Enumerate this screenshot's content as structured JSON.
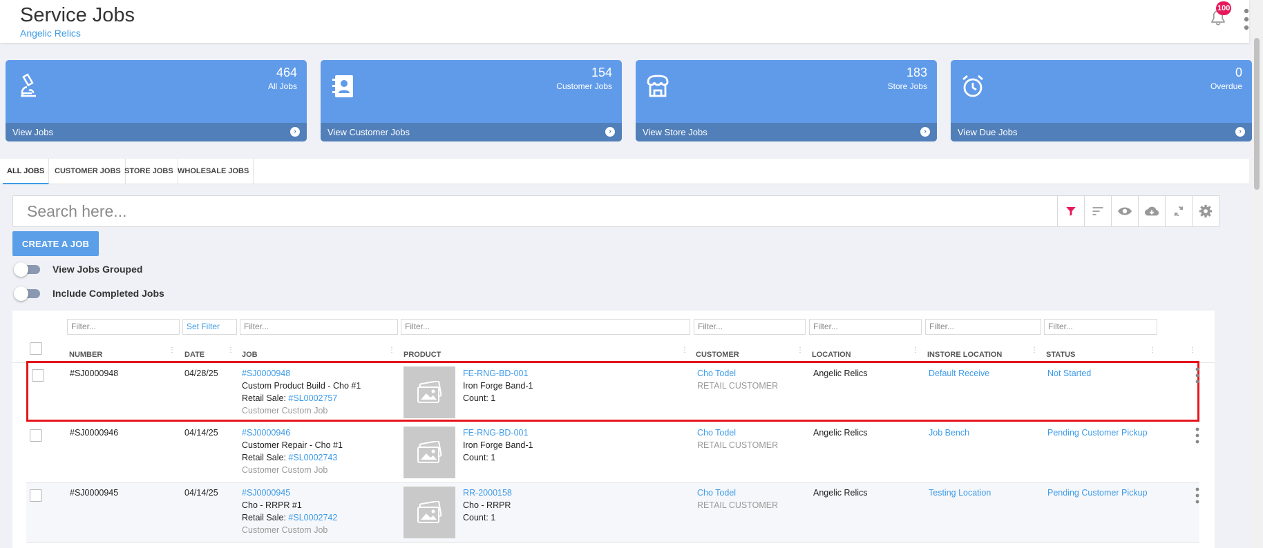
{
  "header": {
    "title": "Service Jobs",
    "subtitle": "Angelic Relics",
    "notification_count": "100"
  },
  "cards": [
    {
      "count": "464",
      "label": "All Jobs",
      "link": "View Jobs",
      "icon": "microscope-icon"
    },
    {
      "count": "154",
      "label": "Customer Jobs",
      "link": "View Customer Jobs",
      "icon": "contact-book-icon"
    },
    {
      "count": "183",
      "label": "Store Jobs",
      "link": "View Store Jobs",
      "icon": "store-icon"
    },
    {
      "count": "0",
      "label": "Overdue",
      "link": "View Due Jobs",
      "icon": "alarm-clock-icon"
    }
  ],
  "tabs": [
    "ALL JOBS",
    "CUSTOMER JOBS",
    "STORE JOBS",
    "WHOLESALE JOBS"
  ],
  "search": {
    "placeholder": "Search here..."
  },
  "toolbar_icons": [
    "filter-icon",
    "sort-icon",
    "eye-icon",
    "cloud-download-icon",
    "refresh-icon",
    "settings-icon"
  ],
  "create_button": "CREATE A JOB",
  "toggles": [
    {
      "label": "View Jobs Grouped",
      "on": false
    },
    {
      "label": "Include Completed Jobs",
      "on": false
    }
  ],
  "filters": {
    "placeholder": "Filter...",
    "set_filter": "Set Filter"
  },
  "columns": [
    "NUMBER",
    "DATE",
    "JOB",
    "PRODUCT",
    "CUSTOMER",
    "LOCATION",
    "INSTORE LOCATION",
    "STATUS"
  ],
  "rows": [
    {
      "number": "#SJ0000948",
      "date": "04/28/25",
      "job_id": "#SJ0000948",
      "job_title": "Custom Product Build - Cho #1",
      "retail_label": "Retail Sale:",
      "retail_sale": "#SL0002757",
      "job_type": "Customer Custom Job",
      "sku": "FE-RNG-BD-001",
      "product": "Iron Forge Band-1",
      "count": "Count: 1",
      "customer": "Cho Todel",
      "customer_type": "RETAIL CUSTOMER",
      "location": "Angelic Relics",
      "instore": "Default Receive",
      "status": "Not Started"
    },
    {
      "number": "#SJ0000946",
      "date": "04/14/25",
      "job_id": "#SJ0000946",
      "job_title": "Customer Repair - Cho #1",
      "retail_label": "Retail Sale:",
      "retail_sale": "#SL0002743",
      "job_type": "Customer Custom Job",
      "sku": "FE-RNG-BD-001",
      "product": "Iron Forge Band-1",
      "count": "Count: 1",
      "customer": "Cho Todel",
      "customer_type": "RETAIL CUSTOMER",
      "location": "Angelic Relics",
      "instore": "Job Bench",
      "status": "Pending Customer Pickup"
    },
    {
      "number": "#SJ0000945",
      "date": "04/14/25",
      "job_id": "#SJ0000945",
      "job_title": "Cho - RRPR #1",
      "retail_label": "Retail Sale:",
      "retail_sale": "#SL0002742",
      "job_type": "Customer Custom Job",
      "sku": "RR-2000158",
      "product": "Cho - RRPR",
      "count": "Count: 1",
      "customer": "Cho Todel",
      "customer_type": "RETAIL CUSTOMER",
      "location": "Angelic Relics",
      "instore": "Testing Location",
      "status": "Pending Customer Pickup"
    }
  ],
  "colors": {
    "accent": "#609bea",
    "link": "#3d9be9",
    "highlight": "#e6151c",
    "badge": "#e6195a"
  }
}
